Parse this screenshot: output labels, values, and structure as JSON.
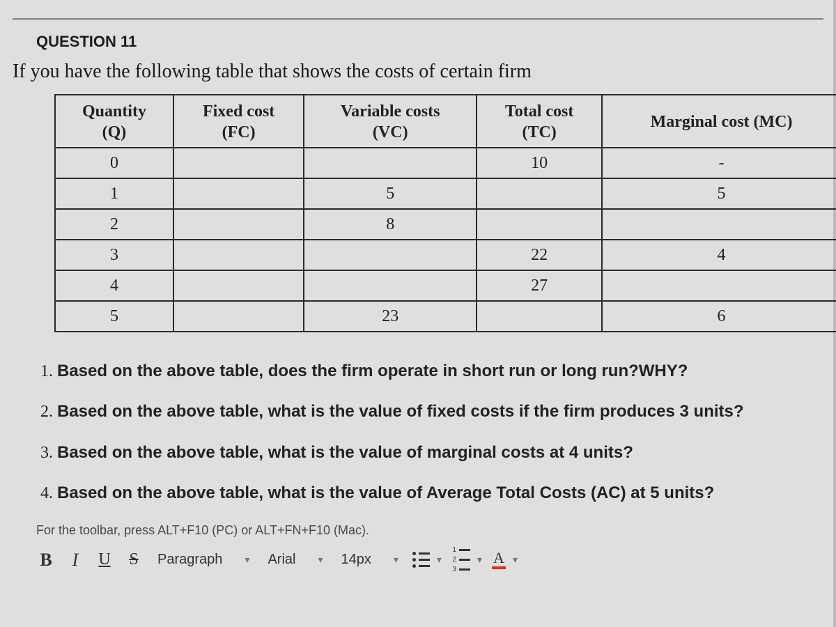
{
  "question_label": "QUESTION 11",
  "intro": "If you have the following table that shows the costs of certain firm",
  "table": {
    "headers": [
      {
        "title": "Quantity",
        "sub": "(Q)"
      },
      {
        "title": "Fixed cost",
        "sub": "(FC)"
      },
      {
        "title": "Variable costs",
        "sub": "(VC)"
      },
      {
        "title": "Total cost",
        "sub": "(TC)"
      },
      {
        "title": "Marginal cost (MC)",
        "sub": ""
      }
    ],
    "rows": [
      {
        "q": "0",
        "fc": "",
        "vc": "",
        "tc": "10",
        "mc": "-"
      },
      {
        "q": "1",
        "fc": "",
        "vc": "5",
        "tc": "",
        "mc": "5"
      },
      {
        "q": "2",
        "fc": "",
        "vc": "8",
        "tc": "",
        "mc": ""
      },
      {
        "q": "3",
        "fc": "",
        "vc": "",
        "tc": "22",
        "mc": "4"
      },
      {
        "q": "4",
        "fc": "",
        "vc": "",
        "tc": "27",
        "mc": ""
      },
      {
        "q": "5",
        "fc": "",
        "vc": "23",
        "tc": "",
        "mc": "6"
      }
    ]
  },
  "prompts": [
    "Based on the above table, does the firm operate in short run or long run?WHY?",
    "Based on the above table, what is the value of fixed costs if the firm produces 3 units?",
    "Based on the above table, what is the value of marginal costs at 4 units?",
    "Based on the above table, what is the value of Average Total Costs (AC) at 5 units?"
  ],
  "editor": {
    "hint": "For the toolbar, press ALT+F10 (PC) or ALT+FN+F10 (Mac).",
    "bold": "B",
    "italic": "I",
    "underline": "U",
    "strike": "S",
    "block_format": "Paragraph",
    "font_family": "Arial",
    "font_size": "14px",
    "text_color_letter": "A"
  },
  "chart_data": {
    "type": "table",
    "columns": [
      "Quantity (Q)",
      "Fixed cost (FC)",
      "Variable costs (VC)",
      "Total cost (TC)",
      "Marginal cost (MC)"
    ],
    "rows": [
      [
        0,
        null,
        null,
        10,
        null
      ],
      [
        1,
        null,
        5,
        null,
        5
      ],
      [
        2,
        null,
        8,
        null,
        null
      ],
      [
        3,
        null,
        null,
        22,
        4
      ],
      [
        4,
        null,
        null,
        27,
        null
      ],
      [
        5,
        null,
        23,
        null,
        6
      ]
    ]
  }
}
